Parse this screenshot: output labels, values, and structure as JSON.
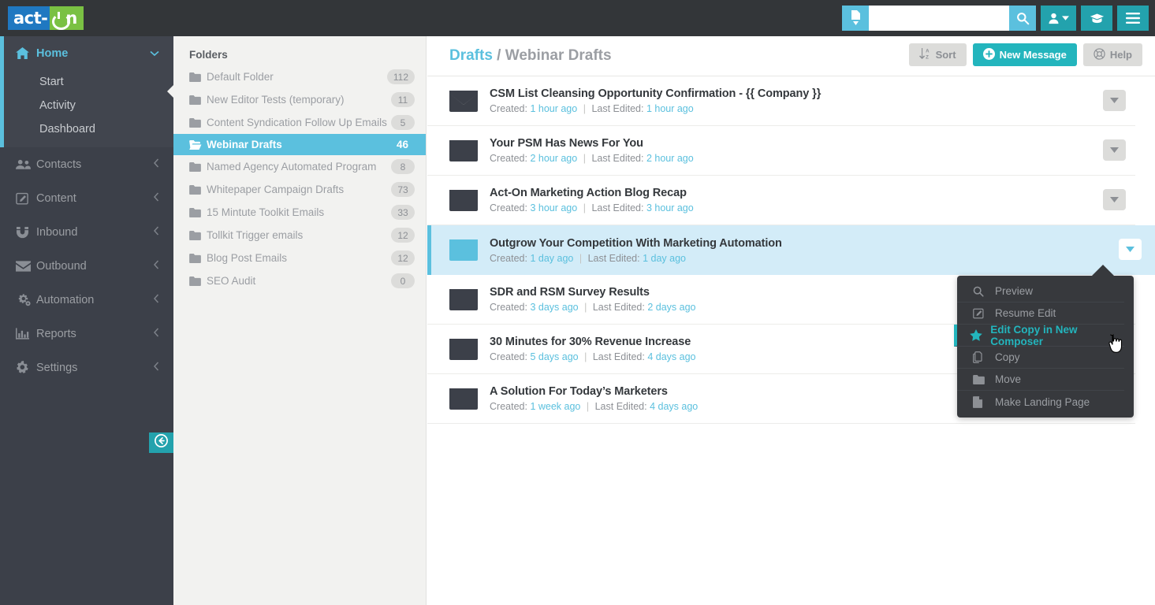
{
  "app": {
    "logo_text_1": "act-",
    "logo_text_2": "n"
  },
  "topbar": {
    "search_value": "",
    "search_placeholder": "",
    "doc_filter_icon": "document-filter-icon",
    "search_icon": "search-icon",
    "user_menu_icon": "user-icon",
    "training_icon": "graduation-cap-icon",
    "hamburger_icon": "hamburger-menu-icon"
  },
  "sidebar": {
    "home": {
      "label": "Home",
      "icon": "home-icon",
      "caret": "chevron-down-icon",
      "sub_items": [
        {
          "label": "Start"
        },
        {
          "label": "Activity"
        },
        {
          "label": "Dashboard"
        }
      ]
    },
    "items": [
      {
        "label": "Contacts",
        "icon": "users-icon"
      },
      {
        "label": "Content",
        "icon": "edit-square-icon"
      },
      {
        "label": "Inbound",
        "icon": "magnet-icon"
      },
      {
        "label": "Outbound",
        "icon": "envelope-icon"
      },
      {
        "label": "Automation",
        "icon": "gears-icon"
      },
      {
        "label": "Reports",
        "icon": "bar-chart-icon"
      },
      {
        "label": "Settings",
        "icon": "gear-icon"
      }
    ],
    "collapse_icon": "arrow-circle-left-icon"
  },
  "folders_panel": {
    "title": "Folders",
    "folders": [
      {
        "name": "Default Folder",
        "count": "112",
        "selected": false
      },
      {
        "name": "New Editor Tests (temporary)",
        "count": "11",
        "selected": false
      },
      {
        "name": "Content Syndication Follow Up Emails",
        "count": "5",
        "selected": false
      },
      {
        "name": "Webinar Drafts",
        "count": "46",
        "selected": true
      },
      {
        "name": "Named Agency Automated Program",
        "count": "8",
        "selected": false
      },
      {
        "name": "Whitepaper Campaign Drafts",
        "count": "73",
        "selected": false
      },
      {
        "name": "15 Mintute Toolkit Emails",
        "count": "33",
        "selected": false
      },
      {
        "name": "Tollkit Trigger emails",
        "count": "12",
        "selected": false
      },
      {
        "name": "Blog Post Emails",
        "count": "12",
        "selected": false
      },
      {
        "name": "SEO Audit",
        "count": "0",
        "selected": false
      }
    ]
  },
  "main": {
    "breadcrumb_root": "Drafts",
    "breadcrumb_sep": " / ",
    "breadcrumb_current": "Webinar Drafts",
    "buttons": {
      "sort": "Sort",
      "new_message": "New Message",
      "help": "Help"
    },
    "meta_labels": {
      "created": "Created:",
      "last_edited": "Last Edited:",
      "separator": "|"
    },
    "messages": [
      {
        "title": "CSM List Cleansing Opportunity Confirmation - {{ Company }}",
        "created": "1 hour ago",
        "last_edited": "1 hour ago",
        "selected": false
      },
      {
        "title": "Your PSM Has News For You",
        "created": "2 hour ago",
        "last_edited": "2 hour ago",
        "selected": false
      },
      {
        "title": "Act-On Marketing Action Blog Recap",
        "created": "3 hour ago",
        "last_edited": "3 hour ago",
        "selected": false
      },
      {
        "title": "Outgrow Your Competition With Marketing Automation",
        "created": "1 day ago",
        "last_edited": "1 day ago",
        "selected": true
      },
      {
        "title": "SDR and RSM Survey Results",
        "created": "3 days ago",
        "last_edited": "2 days ago",
        "selected": false
      },
      {
        "title": "30 Minutes for 30% Revenue Increase",
        "created": "5 days ago",
        "last_edited": "4 days ago",
        "selected": false
      },
      {
        "title": "A Solution For Today’s Marketers",
        "created": "1 week ago",
        "last_edited": "4 days ago",
        "selected": false
      }
    ]
  },
  "context_menu": {
    "items": [
      {
        "label": "Preview",
        "icon": "search-icon",
        "highlighted": false
      },
      {
        "label": "Resume Edit",
        "icon": "edit-square-icon",
        "highlighted": false
      },
      {
        "label": "Edit Copy in New Composer",
        "icon": "star-icon",
        "highlighted": true
      },
      {
        "label": "Copy",
        "icon": "copy-icon",
        "highlighted": false
      },
      {
        "label": "Move",
        "icon": "folder-icon",
        "highlighted": false
      },
      {
        "label": "Make Landing Page",
        "icon": "file-icon",
        "highlighted": false
      }
    ]
  },
  "colors": {
    "accent_blue": "#5bc0de",
    "accent_teal": "#23b5bd",
    "dark_nav": "#3c4049",
    "topbar": "#333639",
    "selected_row_bg": "#d3ecf8",
    "logo_blue": "#1f78c1",
    "logo_green": "#7ac143"
  }
}
